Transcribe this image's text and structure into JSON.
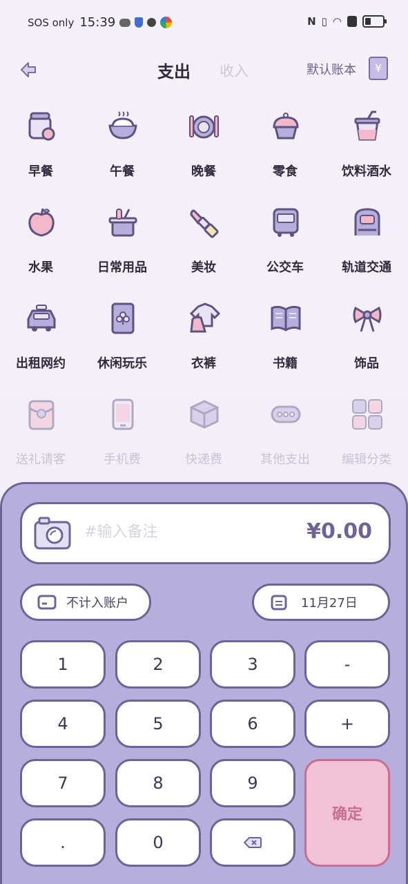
{
  "status_bar": {
    "carrier": "SOS only",
    "time": "15:39"
  },
  "header": {
    "tab_expense": "支出",
    "tab_income": "收入",
    "account": "默认账本",
    "account_icon_glyph": "¥"
  },
  "categories": [
    {
      "label": "早餐",
      "icon": "breakfast-jar-icon"
    },
    {
      "label": "午餐",
      "icon": "rice-bowl-icon"
    },
    {
      "label": "晚餐",
      "icon": "dinner-plate-icon"
    },
    {
      "label": "零食",
      "icon": "cupcake-icon"
    },
    {
      "label": "饮料酒水",
      "icon": "drink-cup-icon"
    },
    {
      "label": "水果",
      "icon": "apple-icon"
    },
    {
      "label": "日常用品",
      "icon": "toiletries-icon"
    },
    {
      "label": "美妆",
      "icon": "lipstick-icon"
    },
    {
      "label": "公交车",
      "icon": "bus-icon"
    },
    {
      "label": "轨道交通",
      "icon": "metro-icon"
    },
    {
      "label": "出租网约",
      "icon": "taxi-icon"
    },
    {
      "label": "休闲玩乐",
      "icon": "playing-card-icon"
    },
    {
      "label": "衣裤",
      "icon": "clothes-icon"
    },
    {
      "label": "书籍",
      "icon": "book-icon"
    },
    {
      "label": "饰品",
      "icon": "bow-icon"
    },
    {
      "label": "送礼请客",
      "icon": "red-envelope-icon"
    },
    {
      "label": "手机费",
      "icon": "phone-icon"
    },
    {
      "label": "快递费",
      "icon": "parcel-icon"
    },
    {
      "label": "其他支出",
      "icon": "more-dots-icon"
    },
    {
      "label": "编辑分类",
      "icon": "edit-grid-icon"
    }
  ],
  "memo": {
    "placeholder": "#输入备注",
    "amount": "¥0.00"
  },
  "account_pill": {
    "label": "不计入账户"
  },
  "date_pill": {
    "label": "11月27日"
  },
  "keys": [
    "1",
    "2",
    "3",
    "-",
    "4",
    "5",
    "6",
    "+",
    "7",
    "8",
    "9",
    ".",
    "0"
  ],
  "confirm_label": "确定",
  "colors": {
    "panel": "#b6aedb",
    "outline": "#6e6394",
    "confirm_bg": "#f1c1d5",
    "confirm_text": "#c76f93"
  }
}
